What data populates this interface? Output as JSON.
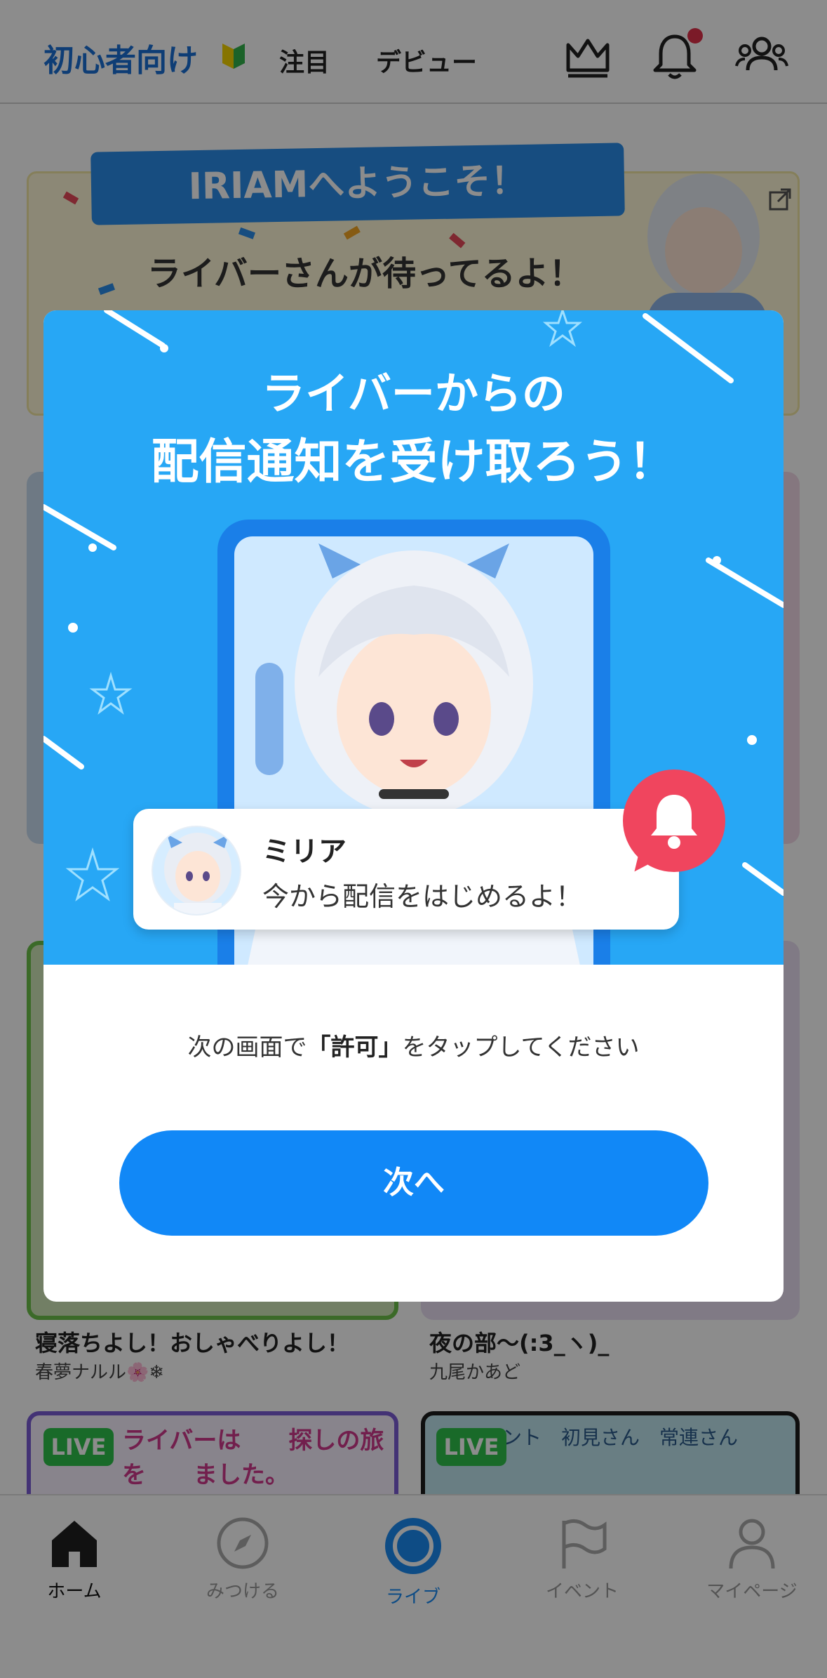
{
  "header": {
    "tabs": [
      {
        "label": "初心者向け"
      },
      {
        "label": "注目"
      },
      {
        "label": "デビュー"
      }
    ]
  },
  "banner": {
    "ribbon_text": "IRIAMへようこそ！",
    "line": "ライバーさんが待ってるよ！"
  },
  "feed": {
    "cards": [
      {
        "title": "寝落ちよし！おしゃべりよし！",
        "subtitle": "春夢ナルル🌸❄"
      },
      {
        "title": "夜の部～(:3_ヽ)_",
        "subtitle": "九尾かあど"
      }
    ],
    "live_badge": "LIVE",
    "left_thumb_text": "ライバーは　　探しの旅を　　ました。",
    "right_thumb_text": "ント　初見さん　常連さん"
  },
  "modal": {
    "title_line1": "ライバーからの",
    "title_line2": "配信通知を受け取ろう！",
    "notification": {
      "name": "ミリア",
      "message": "今から配信をはじめるよ！"
    },
    "instruction": {
      "before": "次の画面で",
      "highlight": "「許可」",
      "after": "をタップしてください"
    },
    "next_button": "次へ"
  },
  "bottom_nav": [
    {
      "label": "ホーム",
      "icon": "home-icon",
      "active": true
    },
    {
      "label": "みつける",
      "icon": "compass-icon",
      "active": false
    },
    {
      "label": "ライブ",
      "icon": "live-icon",
      "active": true
    },
    {
      "label": "イベント",
      "icon": "flag-icon",
      "active": false
    },
    {
      "label": "マイページ",
      "icon": "person-icon",
      "active": false
    }
  ],
  "colors": {
    "accent": "#1188f7",
    "hero_bg": "#27a7f5",
    "bell_badge": "#f0455e",
    "live_badge": "#2fc24c",
    "notification_dot": "#e0304a"
  }
}
